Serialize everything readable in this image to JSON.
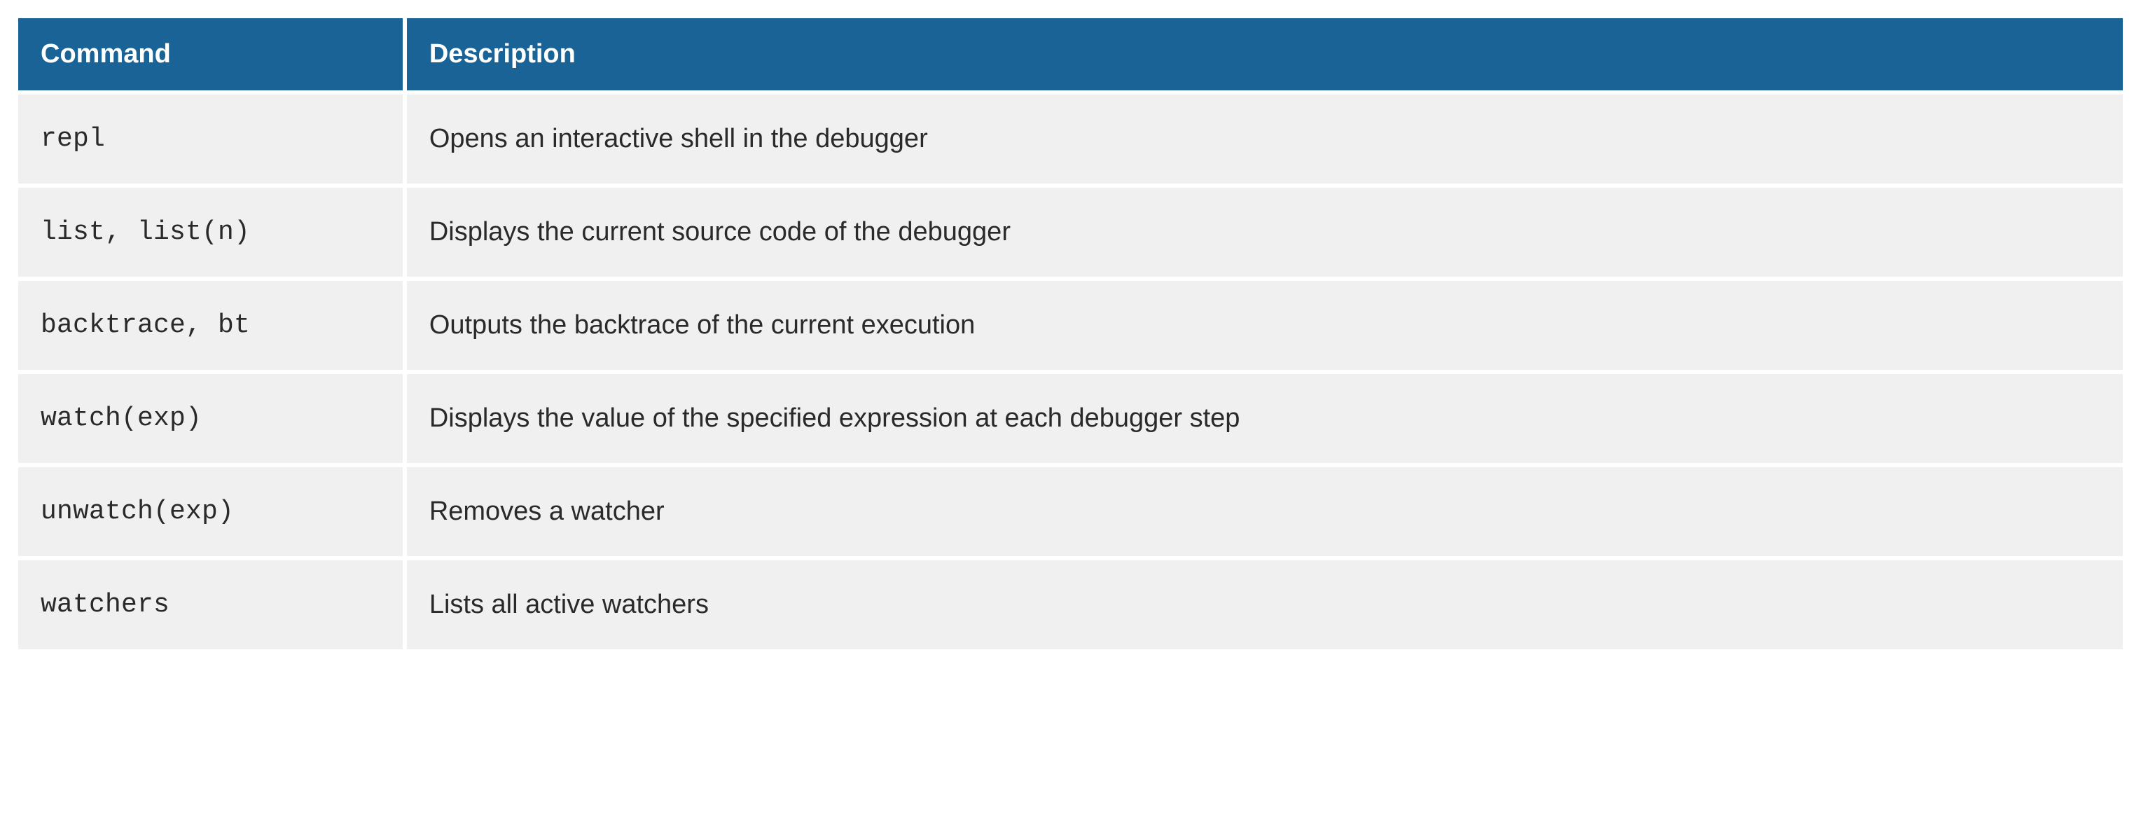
{
  "table": {
    "headers": {
      "command": "Command",
      "description": "Description"
    },
    "rows": [
      {
        "command": "repl",
        "description": "Opens an interactive shell in the debugger"
      },
      {
        "command": "list, list(n)",
        "description": "Displays the current source code of the debugger"
      },
      {
        "command": "backtrace, bt",
        "description": "Outputs the backtrace of the current execution"
      },
      {
        "command": "watch(exp)",
        "description": "Displays the value of the specified expression at each debugger step"
      },
      {
        "command": "unwatch(exp)",
        "description": "Removes a watcher"
      },
      {
        "command": "watchers",
        "description": "Lists all active watchers"
      }
    ]
  }
}
